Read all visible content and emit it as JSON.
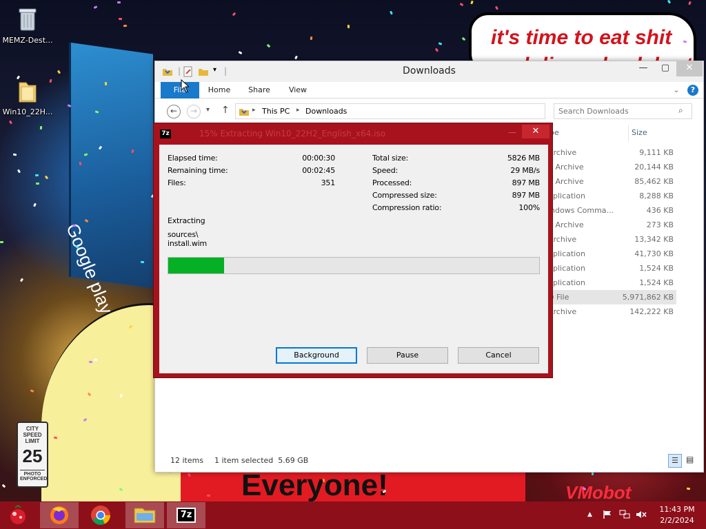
{
  "wallpaper": {
    "bubble_line1": "it's time to eat shit",
    "bubble_line2": "and die and celebrate",
    "banner": "Everyone!",
    "billboard": "Google play",
    "sign": "VMobot",
    "speed_sign_top": "CITY SPEED LIMIT",
    "speed_sign_value": "25",
    "speed_sign_bottom": "PHOTO ENFORCED"
  },
  "desktop_icons": [
    {
      "label": "MEMZ-Dest...",
      "icon": "recycle-bin-icon"
    },
    {
      "label": "Win10_22H...",
      "icon": "folder-icon"
    }
  ],
  "explorer": {
    "title": "Downloads",
    "tabs": [
      "File",
      "Home",
      "Share",
      "View"
    ],
    "path": [
      "This PC",
      "Downloads"
    ],
    "search_placeholder": "Search Downloads",
    "columns": {
      "type": "pe",
      "size": "Size"
    },
    "rows": [
      {
        "type": " Archive",
        "size": "9,111 KB"
      },
      {
        "type": "p Archive",
        "size": "20,144 KB"
      },
      {
        "type": "p Archive",
        "size": "85,462 KB"
      },
      {
        "type": "pplication",
        "size": "8,288 KB"
      },
      {
        "type": "indows Comma...",
        "size": "436 KB"
      },
      {
        "type": "p Archive",
        "size": "273 KB"
      },
      {
        "type": " Archive",
        "size": "13,342 KB"
      },
      {
        "type": "pplication",
        "size": "41,730 KB"
      },
      {
        "type": "pplication",
        "size": "1,524 KB"
      },
      {
        "type": "pplication",
        "size": "1,524 KB"
      },
      {
        "type": "D File",
        "size": "5,971,862 KB"
      },
      {
        "type": " Archive",
        "size": "142,222 KB"
      }
    ],
    "selected_row": 10,
    "status_items": "12 items",
    "status_selected": "1 item selected  5.69 GB"
  },
  "zip": {
    "title": "15% Extracting Win10_22H2_English_x64.iso",
    "left_labels": [
      "Elapsed time:",
      "Remaining time:",
      "Files:"
    ],
    "left_values": [
      "00:00:30",
      "00:02:45",
      "351"
    ],
    "right_labels": [
      "Total size:",
      "Speed:",
      "Processed:",
      "Compressed size:",
      "Compression ratio:"
    ],
    "right_values": [
      "5826 MB",
      "29 MB/s",
      "897 MB",
      "897 MB",
      "100%"
    ],
    "status": "Extracting",
    "path_line1": "sources\\",
    "path_line2": "install.wim",
    "progress": 0.15,
    "buttons": {
      "background": "Background",
      "pause": "Pause",
      "cancel": "Cancel"
    }
  },
  "taskbar": {
    "items": [
      "firefox-icon",
      "chrome-icon",
      "file-explorer-icon",
      "7zip-icon"
    ],
    "time": "11:43 PM",
    "date": "2/2/2024"
  },
  "colors": {
    "taskbar": "#8d0f1a",
    "zip_frame": "#a8121c",
    "progress_fill": "#06b025",
    "file_tab": "#1979ca"
  }
}
